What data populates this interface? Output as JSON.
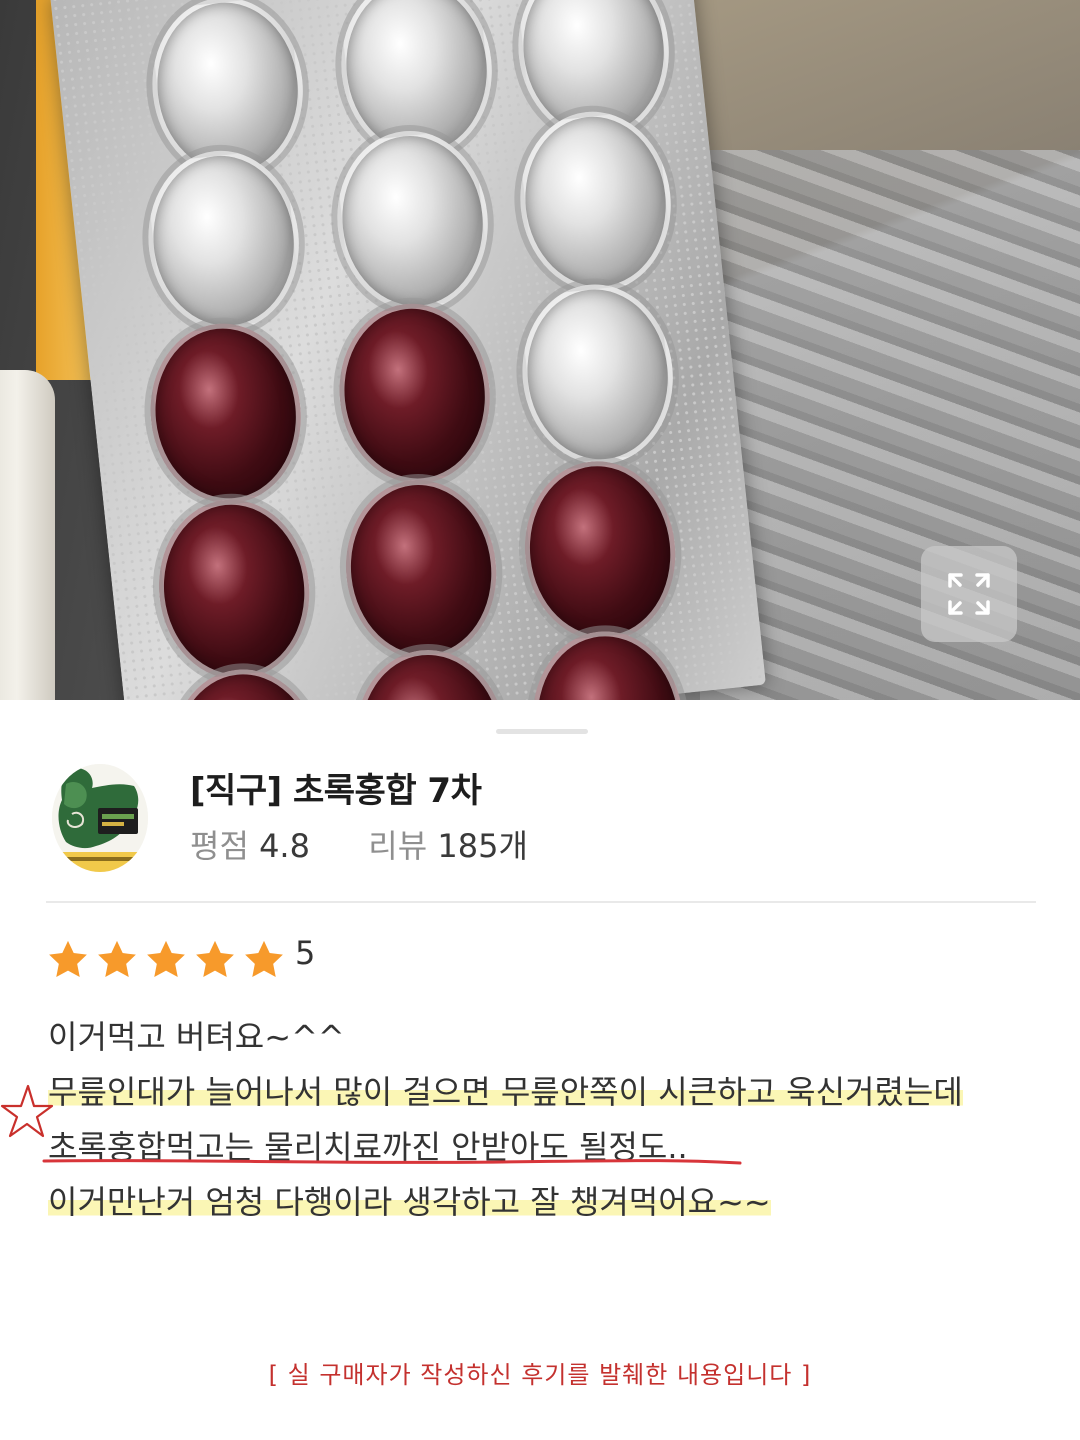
{
  "photo": {
    "expand_icon": "expand-icon"
  },
  "product": {
    "title": "[직구] 초록홍합 7차",
    "rating_label": "평점",
    "rating_value": "4.8",
    "review_label": "리뷰",
    "review_count": "185개"
  },
  "review": {
    "stars": 5,
    "score": "5",
    "lines": [
      "이거먹고 버텨요~^^",
      "무릎인대가 늘어나서 많이 걸으면 무릎안쪽이 시큰하고 욱신거렸는데",
      "초록홍합먹고는 물리치료까진 안받아도 될정도..",
      "이거만난거 엄청 다행이라 생각하고 잘 챙겨먹어요~~"
    ]
  },
  "footer": {
    "notice": "[ 실 구매자가 작성하신 후기를 발췌한 내용입니다 ]"
  },
  "colors": {
    "star": "#f79a2b",
    "highlight": "#fbf6b5",
    "underline": "#d8353a",
    "notice": "#c4312e"
  }
}
